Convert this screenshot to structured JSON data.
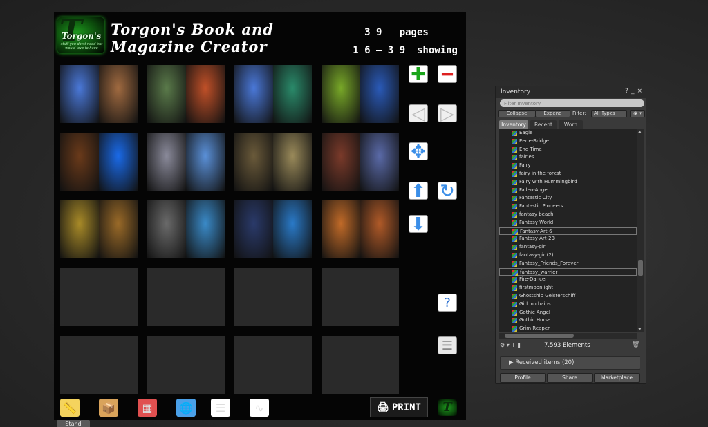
{
  "hud": {
    "logo": {
      "letter": "T",
      "name": "Torgon's",
      "tagline": "stuff you don't need but would love to have"
    },
    "title_line1": "Torgon's Book and",
    "title_line2": "Magazine Creator",
    "pages_count": "3 9",
    "pages_label": "pages",
    "showing_range": "1 6 – 3 9",
    "showing_label": "showing",
    "print_label": "PRINT",
    "logo_small": "T"
  },
  "side_buttons": [
    {
      "name": "add-page-icon",
      "glyph": "✚",
      "bg": "#ffffff",
      "fg": "#1aa51a"
    },
    {
      "name": "remove-page-icon",
      "glyph": "━",
      "bg": "#ffffff",
      "fg": "#dd2020"
    },
    {
      "name": "previous-page-icon",
      "glyph": "◁",
      "bg": "#f0f0f0",
      "fg": "#bdbdbd"
    },
    {
      "name": "next-page-icon",
      "glyph": "▷",
      "bg": "#f0f0f0",
      "fg": "#bdbdbd"
    },
    {
      "name": "fullscreen-icon",
      "glyph": "✥",
      "bg": "#ffffff",
      "fg": "#3a8ee8"
    },
    {
      "name": "move-up-icon",
      "glyph": "⬆",
      "bg": "#ffffff",
      "fg": "#3a8ee8"
    },
    {
      "name": "refresh-icon",
      "glyph": "↻",
      "bg": "#ffffff",
      "fg": "#3a8ee8"
    },
    {
      "name": "move-down-icon",
      "glyph": "⬇",
      "bg": "#ffffff",
      "fg": "#3a8ee8"
    },
    {
      "name": "help-icon",
      "glyph": "?",
      "bg": "#ffffff",
      "fg": "#2a6fd0"
    },
    {
      "name": "list-icon",
      "glyph": "☰",
      "bg": "#e8e8e8",
      "fg": "#888888"
    }
  ],
  "bottom_icons": [
    {
      "name": "ruler-icon",
      "glyph": "📏",
      "bg": "#f4d35e"
    },
    {
      "name": "box-icon",
      "glyph": "📦",
      "bg": "#d9a35b"
    },
    {
      "name": "calendar-icon",
      "glyph": "▦",
      "bg": "#e05050"
    },
    {
      "name": "globe-icon",
      "glyph": "🌐",
      "bg": "#4aa0e8"
    },
    {
      "name": "settings-list-icon",
      "glyph": "☰",
      "bg": "#ffffff"
    },
    {
      "name": "pulse-icon",
      "glyph": "∿",
      "bg": "#ffffff"
    }
  ],
  "page_thumbs": [
    [
      "#4a78d8",
      "#a06a40"
    ],
    [
      "#5a7a4a",
      "#c05028"
    ],
    [
      "#4a78d8",
      "#2a8a6a"
    ],
    [
      "#78a828",
      "#2a5ab8"
    ],
    [
      "#6a3a1a",
      "#1a6ae8"
    ],
    [
      "#8a8a9a",
      "#5a90d8"
    ],
    [
      "#6a5a3a",
      "#9a8a5a"
    ],
    [
      "#7a3a2a",
      "#5a6aa8"
    ],
    [
      "#a88a28",
      "#9a6a28"
    ],
    [
      "#6a6a6a",
      "#3a8ac8"
    ],
    [
      "#2a3a6a",
      "#2a7ac8"
    ],
    [
      "#c06a28",
      "#b05a28"
    ],
    null,
    null,
    null,
    null,
    null,
    null,
    null,
    null
  ],
  "inventory": {
    "title": "Inventory",
    "controls": {
      "help": "?",
      "min": "_",
      "close": "×"
    },
    "filter_placeholder": "Filter Inventory",
    "collapse": "Collapse",
    "expand": "Expand",
    "filter_label": "Filter:",
    "types": "All Types",
    "eye": "◉ ▾",
    "tabs": [
      "Inventory",
      "Recent",
      "Worn"
    ],
    "items": [
      "Eagle",
      "Eerie-Bridge",
      "End Time",
      "fairies",
      "Fairy",
      "fairy in the forest",
      "Fairy with Hummingbird",
      "Fallen-Angel",
      "Fantastic City",
      "Fantastic Pioneers",
      "fantasy beach",
      "Fantasy World",
      "Fantasy-Art-6",
      "Fantasy-Art-23",
      "fantasy-girl",
      "fantasy-girl(2)",
      "Fantasy_Friends_Forever",
      "fantasy_warrior",
      "Fire-Dancer",
      "firstmoonlight",
      "Ghostship  Geisterschiff",
      "Girl in chains...",
      "Gothic Angel",
      "Gothic Horse",
      "Grim Reaper"
    ],
    "highlight": [
      12,
      17
    ],
    "tools": "⚙ ▾   +   ▮",
    "elements": "7.593 Elements",
    "trash": "🗑",
    "received": "Received items (20)",
    "buttons": [
      "Profile",
      "Share",
      "Marketplace"
    ]
  },
  "stand": "Stand"
}
